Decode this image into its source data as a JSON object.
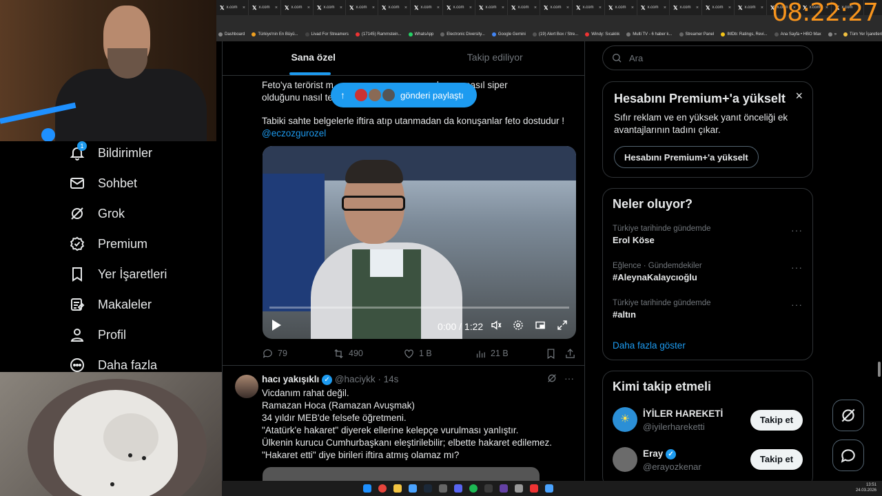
{
  "clock": "08:22:27",
  "browser": {
    "tabs": [
      "x.com",
      "x.com",
      "x.com",
      "x.com",
      "x.com",
      "x.com",
      "x.com",
      "x.com",
      "x.com",
      "x.com",
      "x.com",
      "x.com",
      "x.com",
      "x.com",
      "x.com",
      "x.com",
      "x.com",
      "x.com",
      "x.com",
      "x.com"
    ],
    "tab_close": "×",
    "bookmarks": [
      "Dashboard",
      "Türkiye'nin En Büyü...",
      "Livad For Streamers",
      "(17145) Rammstein...",
      "WhatsApp",
      "Electronic Diversity...",
      "Google Gemini",
      "(19) Alert Box / Stre...",
      "Windy: Sıcaklık",
      "Multi TV - 6 haber k...",
      "Streamer Panel",
      "IMDb: Ratings, Revi...",
      "Ana Sayfa • HBO Max",
      "»",
      "Tüm Yer İşaretleri"
    ]
  },
  "nav": {
    "notifications": {
      "label": "Bildirimler",
      "badge": "1"
    },
    "messages": "Sohbet",
    "grok": "Grok",
    "premium": "Premium",
    "bookmarks": "Yer İşaretleri",
    "articles": "Makaleler",
    "profile": "Profil",
    "more": "Daha fazla"
  },
  "feed": {
    "tab_for_you": "Sana özel",
    "tab_following": "Takip ediliyor",
    "share_pill": "gönderi paylaştı",
    "post1": {
      "line1": "Feto'ya terörist m                                        larının nasıl siper",
      "line2": "olduğunu nasıl te",
      "line3": "Tabiki sahte belgelerle iftira atıp utanmadan da konuşanlar feto dostudur !",
      "mention": "@eczozgurozel",
      "video_time": "0:00 / 1:22",
      "replies": "79",
      "reposts": "490",
      "likes": "1 B",
      "views": "21 B"
    },
    "post2": {
      "name": "hacı yakışıklı",
      "handle": "@haciykk",
      "time": "· 14s",
      "lines": [
        "Vicdanım rahat değil.",
        "Ramazan Hoca (Ramazan Avuşmak)",
        "34 yıldır MEB'de felsefe öğretmeni.",
        "\"Atatürk'e hakaret\" diyerek ellerine kelepçe vurulması yanlıştır.",
        "Ülkenin kurucu Cumhurbaşkanı eleştirilebilir; elbette hakaret edilemez.",
        "\"Hakaret etti\" diye birileri iftira atmış olamaz mı?"
      ]
    }
  },
  "sidebar": {
    "search_placeholder": "Ara",
    "premium": {
      "title": "Hesabını Premium+'a yükselt",
      "desc": "Sıfır reklam ve en yüksek yanıt önceliği ek avantajlarının tadını çıkar.",
      "button": "Hesabını Premium+'a yükselt"
    },
    "trends": {
      "title": "Neler oluyor?",
      "items": [
        {
          "meta": "Türkiye tarihinde gündemde",
          "name": "Erol Köse"
        },
        {
          "meta": "Eğlence · Gündemdekiler",
          "name": "#AleynaKalaycıoğlu"
        },
        {
          "meta": "Türkiye tarihinde gündemde",
          "name": "#altın"
        }
      ],
      "more": "Daha fazla göster"
    },
    "who_to_follow": {
      "title": "Kimi takip etmeli",
      "items": [
        {
          "name": "İYİLER HAREKETİ",
          "handle": "@iyilerhareketti",
          "button": "Takip et"
        },
        {
          "name": "Eray",
          "handle": "@erayozkenar",
          "button": "Takip et"
        }
      ]
    }
  },
  "taskbar": {
    "time": "13:51",
    "date": "24.03.2026"
  },
  "colors": {
    "accent": "#1d9bf0",
    "clock": "#f7941d"
  }
}
